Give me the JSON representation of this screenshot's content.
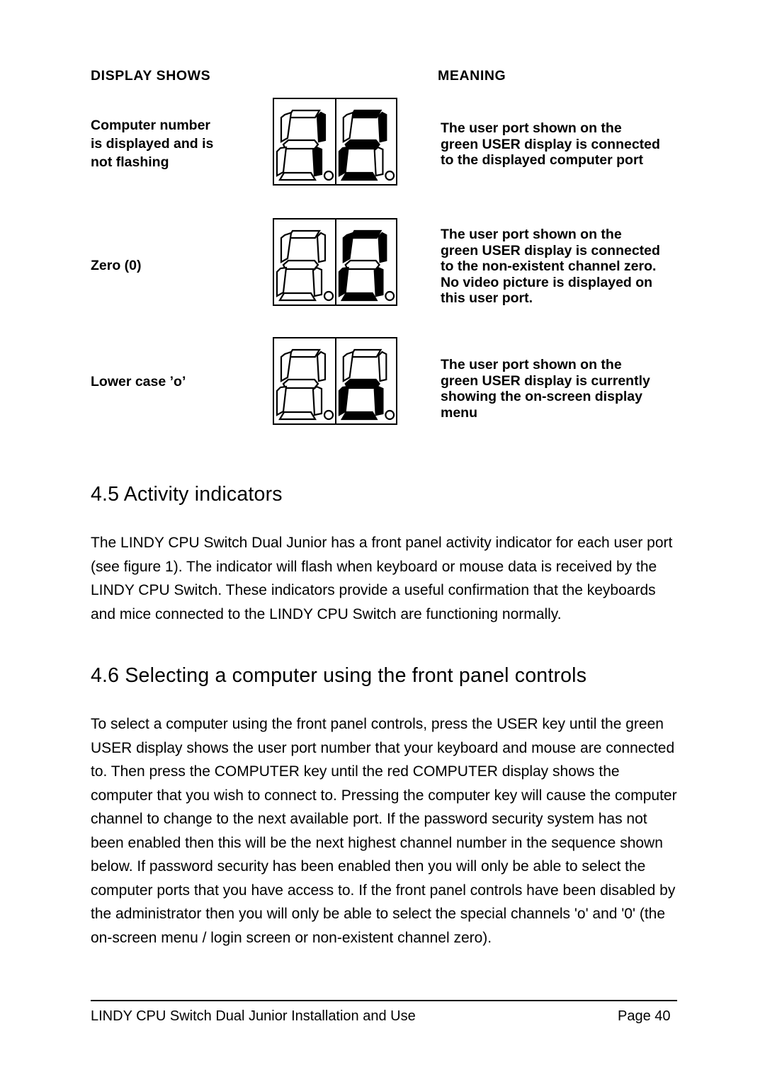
{
  "table": {
    "header_left": "DISPLAY SHOWS",
    "header_right": "MEANING",
    "rows": [
      {
        "label": "Computer number\nis displayed and is\nnot flashing",
        "label_lines": [
          "Computer number",
          "is displayed and is",
          "not flashing"
        ],
        "display": {
          "digits": [
            "1",
            "2"
          ],
          "decimal_points": [
            false,
            false
          ]
        },
        "meaning_lines": [
          "The user port shown on the",
          "green USER display is connected",
          "to the displayed computer port"
        ]
      },
      {
        "label": "Zero (0)",
        "label_lines": [
          "Zero (0)"
        ],
        "display": {
          "digits": [
            "",
            "0"
          ],
          "decimal_points": [
            false,
            false
          ]
        },
        "meaning_lines": [
          "The user port shown on the",
          "green USER display is connected",
          "to the non-existent channel zero.",
          "No video picture is displayed on",
          "this user port."
        ]
      },
      {
        "label": "Lower case ’o’",
        "label_lines": [
          "Lower case ’o’"
        ],
        "display": {
          "digits": [
            "",
            "o"
          ],
          "decimal_points": [
            false,
            false
          ]
        },
        "meaning_lines": [
          "The user port shown on the",
          "green USER display is currently",
          "showing the on-screen display",
          "menu"
        ]
      }
    ]
  },
  "sections": [
    {
      "heading": "4.5 Activity indicators",
      "body": "The LINDY CPU Switch Dual Junior has a front panel activity indicator for each user port (see figure 1). The indicator will flash when keyboard or mouse data is received by the LINDY CPU Switch. These indicators provide a useful confirmation that the keyboards and mice connected to the LINDY CPU Switch are functioning normally."
    },
    {
      "heading": "4.6 Selecting a computer using the front panel controls",
      "body": "To select a computer using the front panel controls, press the USER key until the green USER display shows the user port number that your keyboard and mouse are connected to. Then press the COMPUTER key until the red COMPUTER display shows the computer that you wish to connect to. Pressing the computer key will cause the computer channel to change to the next available port. If the password security system has not been enabled then this will be the next highest channel number in the sequence shown below. If password security has been enabled then you will only be able to select the computer ports that you have access to. If the front panel controls have been disabled by the administrator then you will only be able to select the special channels 'o' and '0' (the on-screen menu / login screen or non-existent channel zero)."
    }
  ],
  "footer": {
    "left": "LINDY CPU Switch Dual Junior  Installation and Use",
    "right": "Page 40"
  },
  "colors": {
    "ink": "#000000",
    "paper": "#ffffff"
  }
}
